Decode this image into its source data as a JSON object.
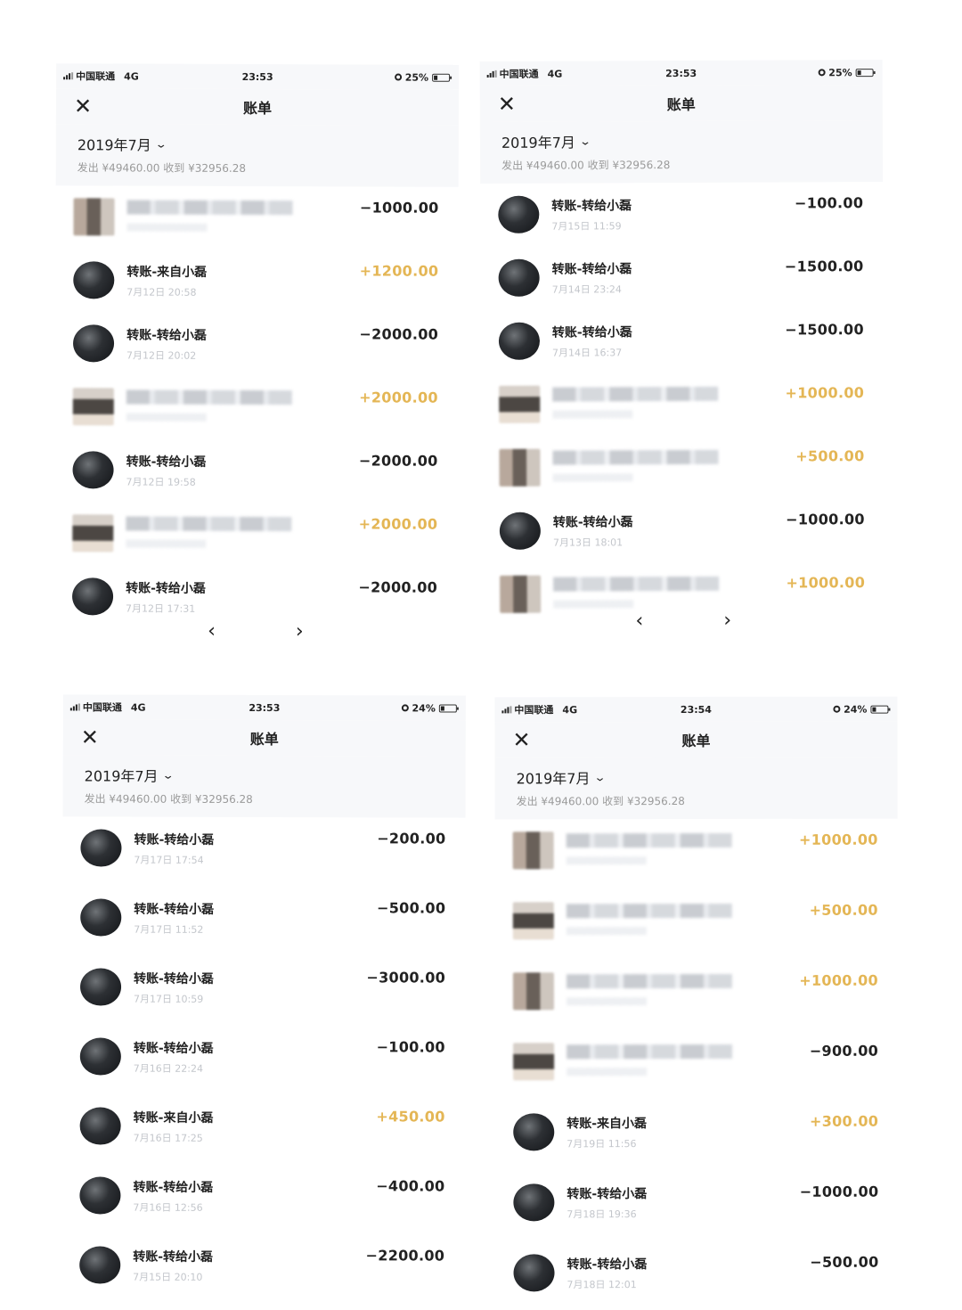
{
  "screens": [
    {
      "status": {
        "carrier": "中国联通",
        "network": "4G",
        "time": "23:53",
        "battery": "25%"
      },
      "nav": {
        "close": "✕",
        "title": "账单"
      },
      "summary": {
        "month": "2019年7月",
        "totals": "发出 ¥49460.00 收到 ¥32956.28"
      },
      "pager": {
        "prev": "‹",
        "next": "›"
      },
      "rows": [
        {
          "title": "",
          "date": "",
          "amount": "−1000.00",
          "direction": "out",
          "obscured": true
        },
        {
          "title": "转账-来自小磊",
          "date": "7月12日 20:58",
          "amount": "+1200.00",
          "direction": "in",
          "obscured": false
        },
        {
          "title": "转账-转给小磊",
          "date": "7月12日 20:02",
          "amount": "−2000.00",
          "direction": "out",
          "obscured": false
        },
        {
          "title": "",
          "date": "",
          "amount": "+2000.00",
          "direction": "in",
          "obscured": true
        },
        {
          "title": "转账-转给小磊",
          "date": "7月12日 19:58",
          "amount": "−2000.00",
          "direction": "out",
          "obscured": false
        },
        {
          "title": "",
          "date": "",
          "amount": "+2000.00",
          "direction": "in",
          "obscured": true
        },
        {
          "title": "转账-转给小磊",
          "date": "7月12日 17:31",
          "amount": "−2000.00",
          "direction": "out",
          "obscured": false
        }
      ]
    },
    {
      "status": {
        "carrier": "中国联通",
        "network": "4G",
        "time": "23:53",
        "battery": "25%"
      },
      "nav": {
        "close": "✕",
        "title": "账单"
      },
      "summary": {
        "month": "2019年7月",
        "totals": "发出 ¥49460.00 收到 ¥32956.28"
      },
      "pager": {
        "prev": "‹",
        "next": "›"
      },
      "rows": [
        {
          "title": "转账-转给小磊",
          "date": "7月15日 11:59",
          "amount": "−100.00",
          "direction": "out",
          "obscured": false
        },
        {
          "title": "转账-转给小磊",
          "date": "7月14日 23:24",
          "amount": "−1500.00",
          "direction": "out",
          "obscured": false
        },
        {
          "title": "转账-转给小磊",
          "date": "7月14日 16:37",
          "amount": "−1500.00",
          "direction": "out",
          "obscured": false
        },
        {
          "title": "",
          "date": "",
          "amount": "+1000.00",
          "direction": "in",
          "obscured": true
        },
        {
          "title": "",
          "date": "",
          "amount": "+500.00",
          "direction": "in",
          "obscured": true
        },
        {
          "title": "转账-转给小磊",
          "date": "7月13日 18:01",
          "amount": "−1000.00",
          "direction": "out",
          "obscured": false
        },
        {
          "title": "",
          "date": "",
          "amount": "+1000.00",
          "direction": "in",
          "obscured": true
        }
      ]
    },
    {
      "status": {
        "carrier": "中国联通",
        "network": "4G",
        "time": "23:53",
        "battery": "24%"
      },
      "nav": {
        "close": "✕",
        "title": "账单"
      },
      "summary": {
        "month": "2019年7月",
        "totals": "发出 ¥49460.00 收到 ¥32956.28"
      },
      "rows": [
        {
          "title": "转账-转给小磊",
          "date": "7月17日 17:54",
          "amount": "−200.00",
          "direction": "out",
          "obscured": false
        },
        {
          "title": "转账-转给小磊",
          "date": "7月17日 11:52",
          "amount": "−500.00",
          "direction": "out",
          "obscured": false
        },
        {
          "title": "转账-转给小磊",
          "date": "7月17日 10:59",
          "amount": "−3000.00",
          "direction": "out",
          "obscured": false
        },
        {
          "title": "转账-转给小磊",
          "date": "7月16日 22:24",
          "amount": "−100.00",
          "direction": "out",
          "obscured": false
        },
        {
          "title": "转账-来自小磊",
          "date": "7月16日 17:25",
          "amount": "+450.00",
          "direction": "in",
          "obscured": false
        },
        {
          "title": "转账-转给小磊",
          "date": "7月16日 12:56",
          "amount": "−400.00",
          "direction": "out",
          "obscured": false
        },
        {
          "title": "转账-转给小磊",
          "date": "7月15日 20:10",
          "amount": "−2200.00",
          "direction": "out",
          "obscured": false
        }
      ]
    },
    {
      "status": {
        "carrier": "中国联通",
        "network": "4G",
        "time": "23:54",
        "battery": "24%"
      },
      "nav": {
        "close": "✕",
        "title": "账单"
      },
      "summary": {
        "month": "2019年7月",
        "totals": "发出 ¥49460.00 收到 ¥32956.28"
      },
      "rows": [
        {
          "title": "",
          "date": "",
          "amount": "+1000.00",
          "direction": "in",
          "obscured": true
        },
        {
          "title": "",
          "date": "",
          "amount": "+500.00",
          "direction": "in",
          "obscured": true
        },
        {
          "title": "",
          "date": "",
          "amount": "+1000.00",
          "direction": "in",
          "obscured": true
        },
        {
          "title": "",
          "date": "",
          "amount": "−900.00",
          "direction": "out",
          "obscured": true
        },
        {
          "title": "转账-来自小磊",
          "date": "7月19日 11:56",
          "amount": "+300.00",
          "direction": "in",
          "obscured": false
        },
        {
          "title": "转账-转给小磊",
          "date": "7月18日 19:36",
          "amount": "−1000.00",
          "direction": "out",
          "obscured": false
        },
        {
          "title": "转账-转给小磊",
          "date": "7月18日 12:01",
          "amount": "−500.00",
          "direction": "out",
          "obscured": false
        }
      ]
    }
  ]
}
